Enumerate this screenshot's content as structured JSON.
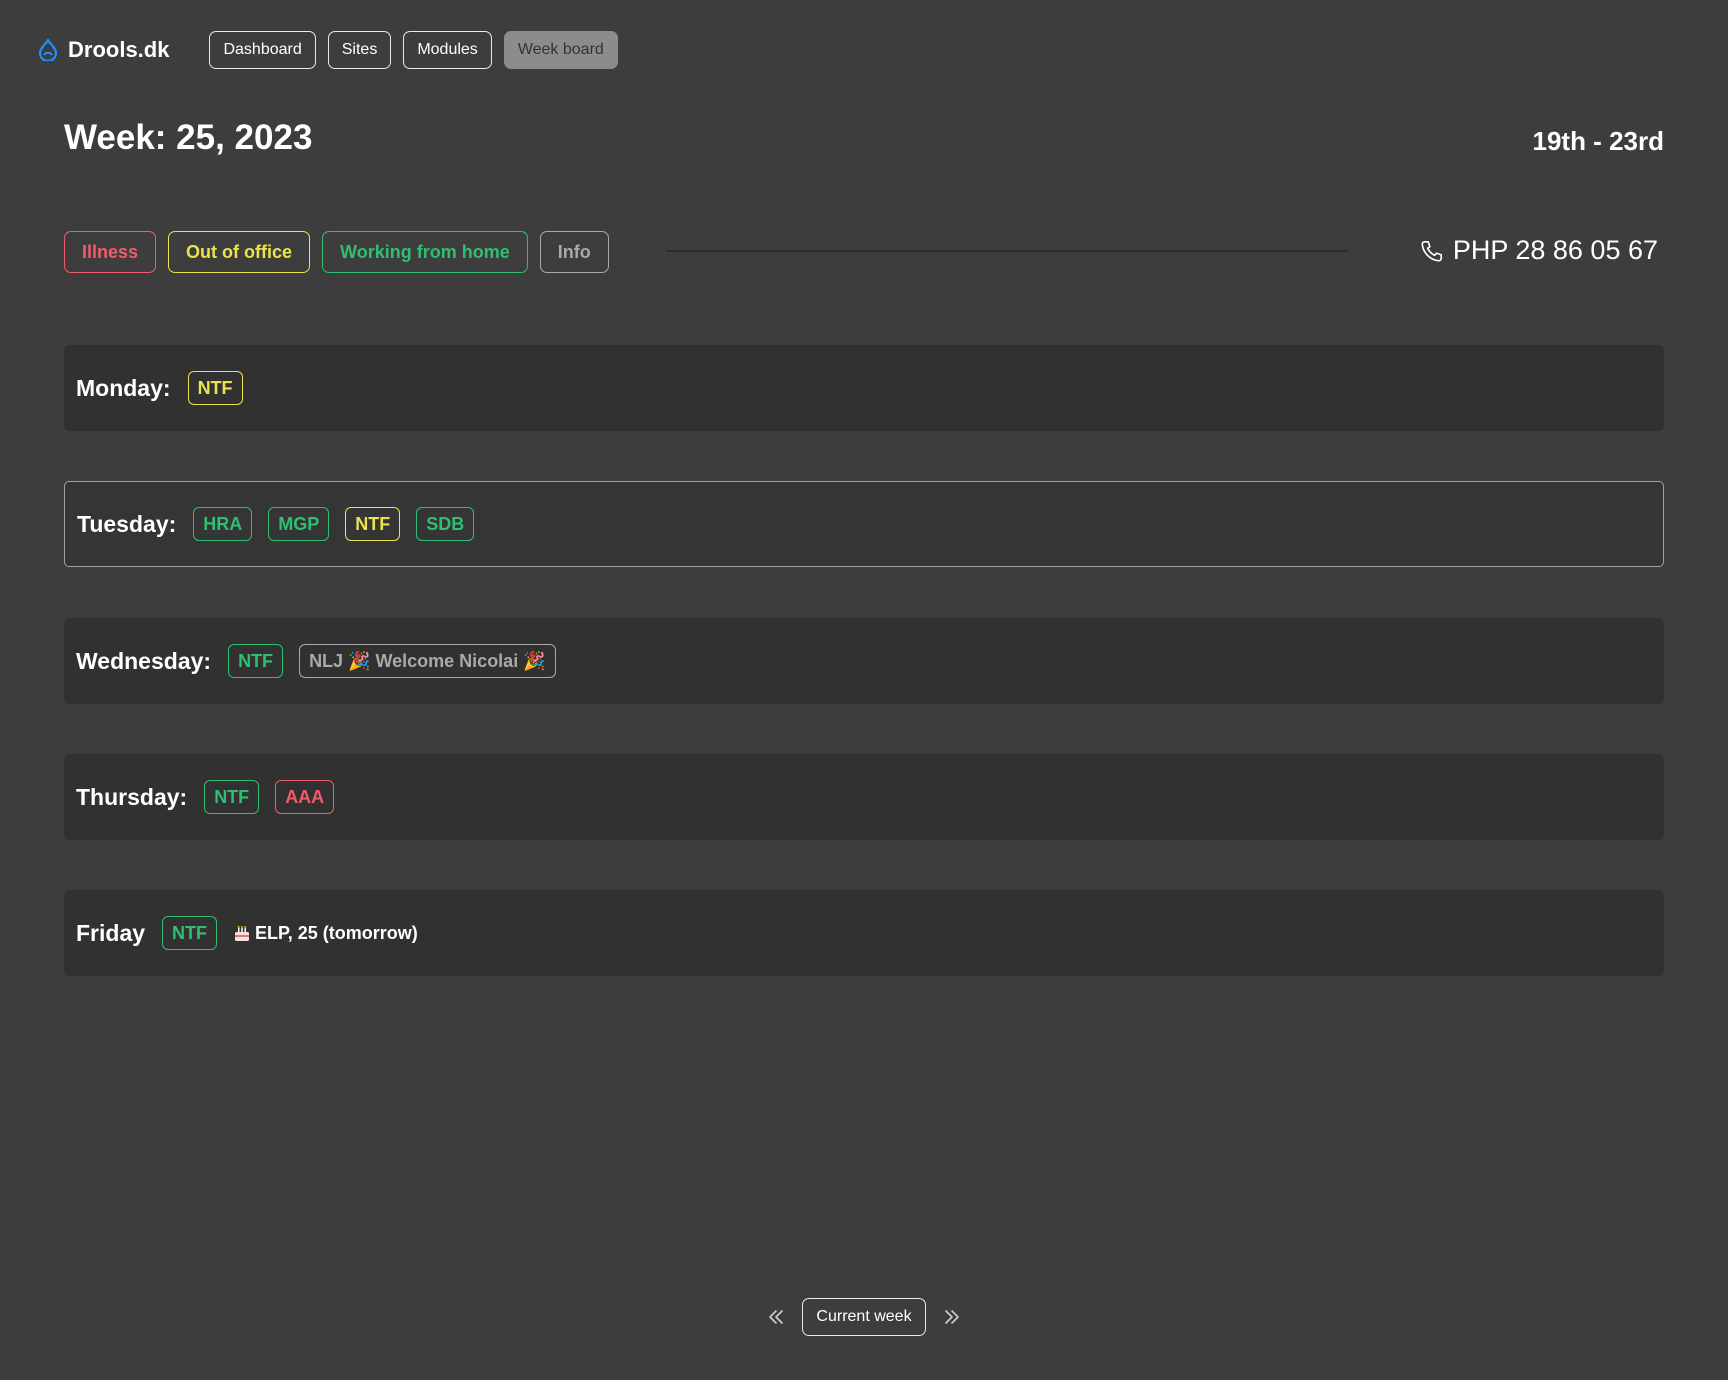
{
  "header": {
    "brand": "Drools.dk",
    "brand_icon": "drupal-drop-icon",
    "nav": [
      "Dashboard",
      "Sites",
      "Modules",
      "Week board"
    ],
    "active_nav": "Week board"
  },
  "week": {
    "title": "Week: 25, 2023",
    "range": "19th - 23rd"
  },
  "legend": {
    "illness": "Illness",
    "out_of_office": "Out of office",
    "working_from_home": "Working from home",
    "info": "Info"
  },
  "phone": {
    "icon": "phone-icon",
    "text": "PHP 28 86 05 67"
  },
  "colors": {
    "background": "#3d3d3d",
    "row": "#313131",
    "green": "#2fbf71",
    "yellow": "#ebe34b",
    "red": "#ef5d6a",
    "gray": "#a9a9a9",
    "brand_icon": "#1e90ff"
  },
  "days": {
    "monday": {
      "label": "Monday:",
      "tags": [
        "NTF"
      ]
    },
    "tuesday": {
      "label": "Tuesday:",
      "tags": [
        "HRA",
        "MGP",
        "NTF",
        "SDB"
      ]
    },
    "wednesday": {
      "label": "Wednesday:",
      "tags": [
        "NTF",
        "NLJ 🎉 Welcome Nicolai 🎉"
      ]
    },
    "thursday": {
      "label": "Thursday:",
      "tags": [
        "NTF",
        "AAA"
      ]
    },
    "friday": {
      "label": "Friday",
      "tags": [
        "NTF"
      ],
      "birthday": "ELP, 25 (tomorrow)",
      "birthday_icon": "cake-icon"
    }
  },
  "pager": {
    "prev_icon": "chevrons-left-icon",
    "current": "Current week",
    "next_icon": "chevrons-right-icon"
  }
}
